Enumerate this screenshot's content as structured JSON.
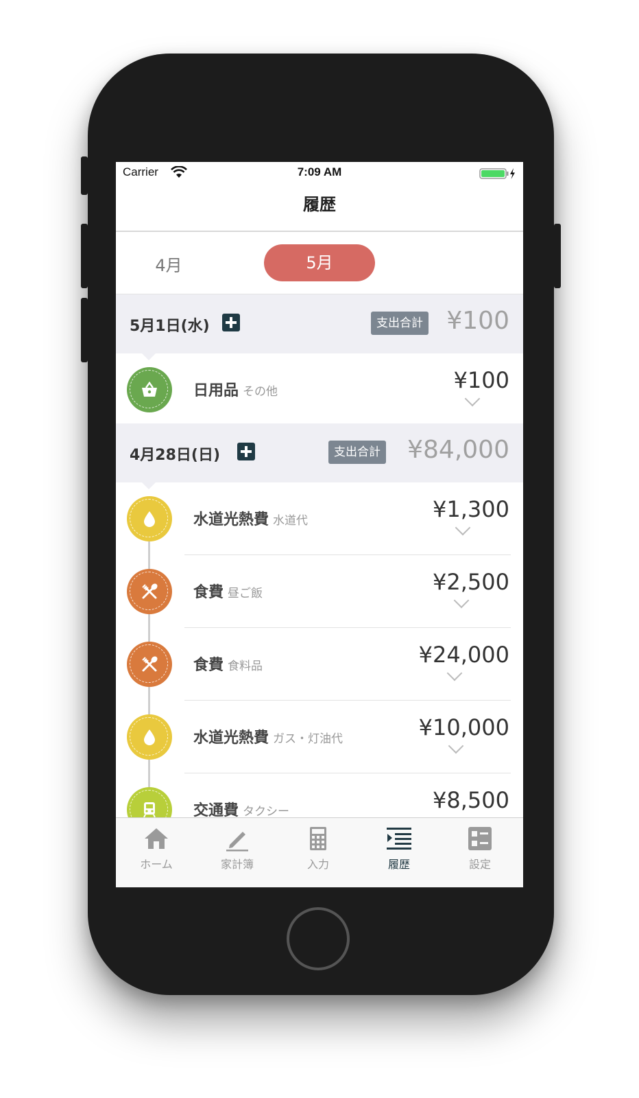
{
  "status_bar": {
    "carrier": "Carrier",
    "time": "7:09 AM"
  },
  "nav": {
    "title": "履歴"
  },
  "month_tabs": [
    {
      "label": "4月",
      "selected": false
    },
    {
      "label": "5月",
      "selected": true
    }
  ],
  "days": [
    {
      "date": "5月1日(水)",
      "total_label": "支出合計",
      "total": "¥100",
      "entries": [
        {
          "category": "日用品",
          "subcategory": "その他",
          "amount": "¥100",
          "icon": "basket-icon",
          "color": "#6aa84f"
        }
      ]
    },
    {
      "date": "4月28日(日)",
      "total_label": "支出合計",
      "total": "¥84,000",
      "entries": [
        {
          "category": "水道光熱費",
          "subcategory": "水道代",
          "amount": "¥1,300",
          "icon": "water-drop-icon",
          "color": "#e9c93e"
        },
        {
          "category": "食費",
          "subcategory": "昼ご飯",
          "amount": "¥2,500",
          "icon": "fork-spoon-icon",
          "color": "#d97a3d"
        },
        {
          "category": "食費",
          "subcategory": "食料品",
          "amount": "¥24,000",
          "icon": "fork-spoon-icon",
          "color": "#d97a3d"
        },
        {
          "category": "水道光熱費",
          "subcategory": "ガス・灯油代",
          "amount": "¥10,000",
          "icon": "water-drop-icon",
          "color": "#e9c93e"
        },
        {
          "category": "交通費",
          "subcategory": "タクシー",
          "amount": "¥8,500",
          "icon": "train-icon",
          "color": "#b8cf3a"
        }
      ]
    }
  ],
  "tab_bar": [
    {
      "label": "ホーム",
      "icon": "home-icon",
      "active": false
    },
    {
      "label": "家計簿",
      "icon": "pencil-icon",
      "active": false
    },
    {
      "label": "入力",
      "icon": "calculator-icon",
      "active": false
    },
    {
      "label": "履歴",
      "icon": "list-icon",
      "active": true
    },
    {
      "label": "設定",
      "icon": "settings-icon",
      "active": false
    }
  ]
}
